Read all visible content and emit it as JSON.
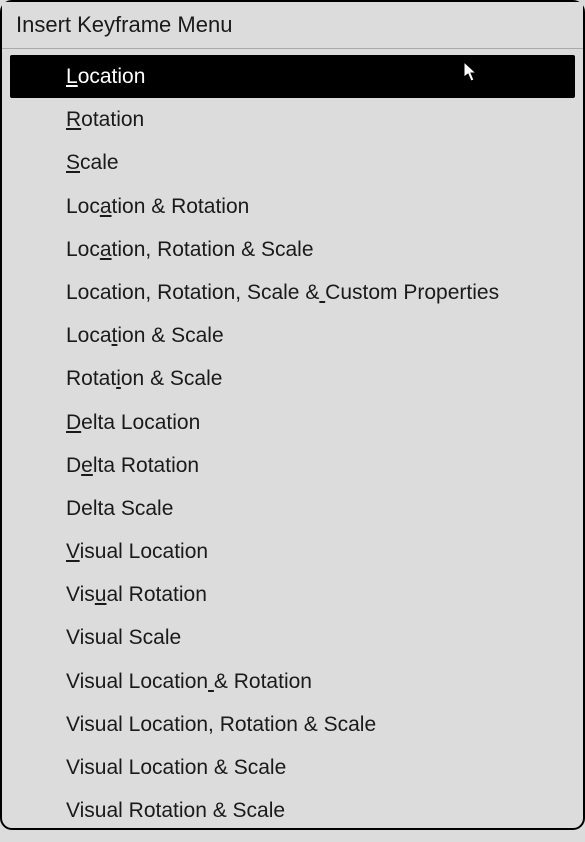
{
  "menu": {
    "title": "Insert Keyframe Menu",
    "highlighted_index": 0,
    "items": [
      {
        "label": "Location",
        "mnemonic_index": 0
      },
      {
        "label": "Rotation",
        "mnemonic_index": 0
      },
      {
        "label": "Scale",
        "mnemonic_index": 0
      },
      {
        "label": "Location & Rotation",
        "mnemonic_index": 3
      },
      {
        "label": "Location, Rotation & Scale",
        "mnemonic_index": 3
      },
      {
        "label": "Location, Rotation, Scale & Custom Properties",
        "mnemonic_index": 27
      },
      {
        "label": "Location & Scale",
        "mnemonic_index": 4
      },
      {
        "label": "Rotation & Scale",
        "mnemonic_index": 5
      },
      {
        "label": "Delta Location",
        "mnemonic_index": 0
      },
      {
        "label": "Delta Rotation",
        "mnemonic_index": 1
      },
      {
        "label": "Delta Scale",
        "mnemonic_index": -1
      },
      {
        "label": "Visual Location",
        "mnemonic_index": 0
      },
      {
        "label": "Visual Rotation",
        "mnemonic_index": 3
      },
      {
        "label": "Visual Scale",
        "mnemonic_index": -1
      },
      {
        "label": "Visual Location & Rotation",
        "mnemonic_index": 15
      },
      {
        "label": "Visual Location, Rotation & Scale",
        "mnemonic_index": -1
      },
      {
        "label": "Visual Location & Scale",
        "mnemonic_index": -1
      },
      {
        "label": "Visual Rotation & Scale",
        "mnemonic_index": -1
      }
    ]
  }
}
